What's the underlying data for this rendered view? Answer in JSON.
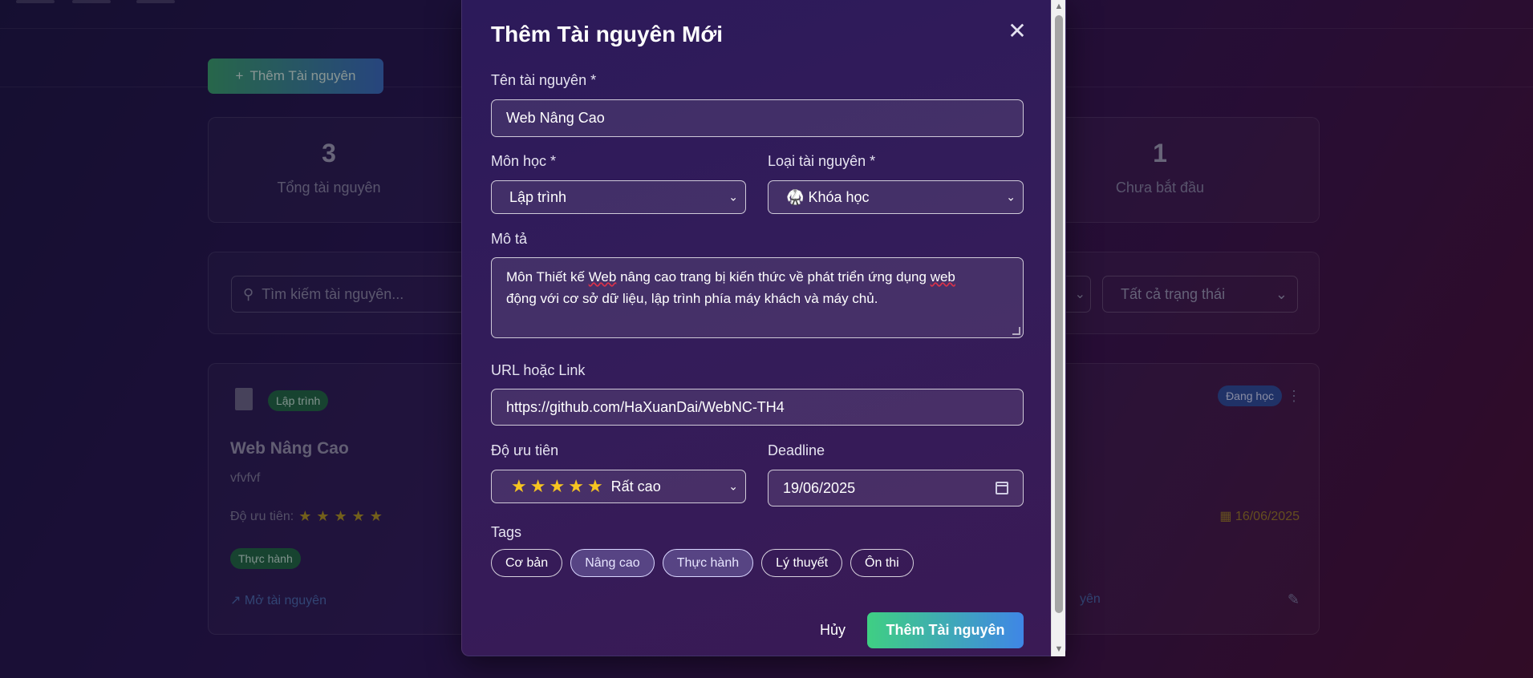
{
  "background": {
    "add_button_label": "Thêm Tài nguyên",
    "stats": [
      {
        "value": "3",
        "label": "Tổng tài nguyên"
      },
      {
        "value": "1",
        "label": "Chưa bắt đầu"
      }
    ],
    "search_placeholder": "Tìm kiếm tài nguyên...",
    "status_filter": "Tất cả trạng thái",
    "card_left": {
      "category": "Lập trình",
      "title": "Web Nâng Cao",
      "description": "vfvfvf",
      "priority_label": "Độ ưu tiên:",
      "tag": "Thực hành",
      "open_link": "Mở tài nguyên"
    },
    "card_right": {
      "status": "Đang học",
      "date": "16/06/2025",
      "link_fragment": "yên"
    }
  },
  "modal": {
    "title": "Thêm Tài nguyên Mới",
    "close_glyph": "✕",
    "name_label": "Tên tài nguyên *",
    "name_value": "Web Nâng Cao",
    "subject_label": "Môn học *",
    "subject_value": "Lập trình",
    "type_label": "Loại tài nguyên *",
    "type_value": "Khóa học",
    "type_emoji": "🥋",
    "desc_label": "Mô tả",
    "desc_part1": "Môn Thiết kế ",
    "desc_spell1": "Web",
    "desc_part2": " nâng cao trang bị kiến thức về phát triển ứng dụng ",
    "desc_spell2": "web",
    "desc_line2": "động với cơ sở dữ liệu, lập trình phía máy khách và máy chủ.",
    "url_label": "URL hoặc Link",
    "url_value": "https://github.com/HaXuanDai/WebNC-TH4",
    "priority_label": "Độ ưu tiên",
    "priority_text": "Rất cao",
    "priority_stars": 5,
    "deadline_label": "Deadline",
    "deadline_value": "19/06/2025",
    "tags_label": "Tags",
    "tags": [
      {
        "label": "Cơ bản",
        "active": false
      },
      {
        "label": "Nâng cao",
        "active": true
      },
      {
        "label": "Thực hành",
        "active": true
      },
      {
        "label": "Lý thuyết",
        "active": false
      },
      {
        "label": "Ôn thi",
        "active": false
      }
    ],
    "cancel_label": "Hủy",
    "submit_label": "Thêm Tài nguyên"
  },
  "colors": {
    "accent_start": "#3fcf83",
    "accent_end": "#3f86e6",
    "star": "#f6c521"
  }
}
